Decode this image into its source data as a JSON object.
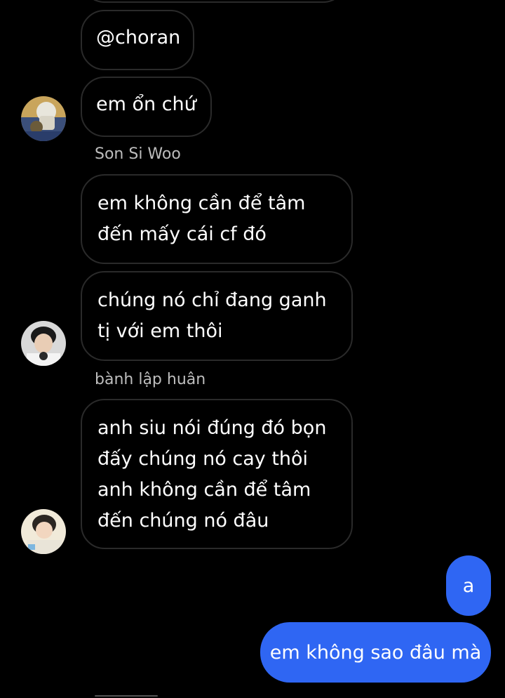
{
  "chat": {
    "messages": [
      {
        "text": "@choran"
      },
      {
        "text": "em ổn chứ"
      },
      {
        "text": "em không cần để tâm đến mấy cái cf đó"
      },
      {
        "text": "chúng nó chỉ đang ganh tị với em thôi"
      },
      {
        "text": "anh siu nói đúng đó bọn đấy chúng nó cay thôi anh không cần để tâm đến chúng nó đâu"
      }
    ],
    "senders": {
      "son_si_woo": "Son Si Woo",
      "banh_lap_huan": "bành lập huân"
    },
    "outgoing": [
      {
        "text": "a"
      },
      {
        "text": "em không sao đâu mà"
      }
    ]
  },
  "colors": {
    "background": "#000000",
    "incoming_border": "#2a2a2a",
    "outgoing_bubble": "#2f66f3",
    "sender_name": "#bdbdbd"
  }
}
